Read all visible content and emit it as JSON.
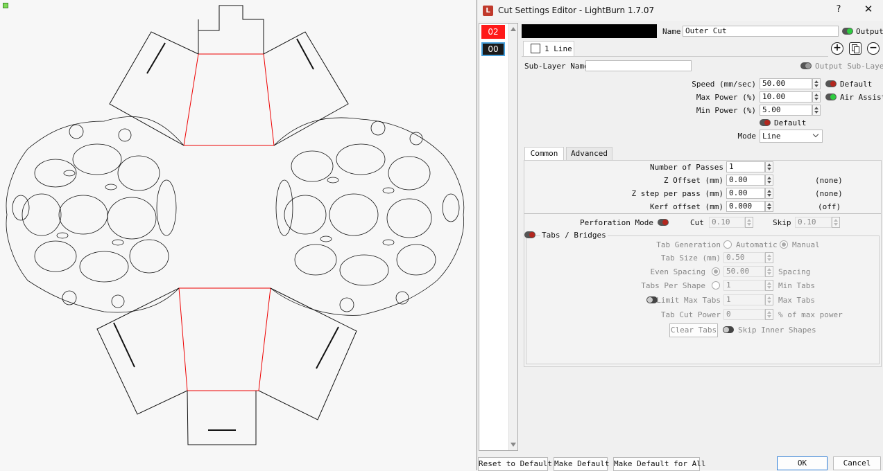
{
  "window": {
    "title": "Cut Settings Editor - LightBurn 1.7.07",
    "help": "?",
    "close": "✕"
  },
  "layers": [
    {
      "label": "02",
      "color": "#ff1a1a"
    },
    {
      "label": "00",
      "color": "#1a1a1a"
    }
  ],
  "header": {
    "name_label": "Name",
    "name_value": "Outer Cut",
    "output_label": "Output",
    "swatch_color": "#000000"
  },
  "sublayer_tab": {
    "label": "1 Line"
  },
  "sublayer": {
    "name_label": "Sub-Layer Name",
    "name_value": "",
    "output_sublayer_label": "Output Sub-Layer"
  },
  "speed": {
    "label": "Speed (mm/sec)",
    "value": "50.00",
    "default_label": "Default"
  },
  "max_power": {
    "label": "Max Power (%)",
    "value": "10.00",
    "air_assist_label": "Air Assist"
  },
  "min_power": {
    "label": "Min Power (%)",
    "value": "5.00"
  },
  "power_default_label": "Default",
  "mode": {
    "label": "Mode",
    "value": "Line"
  },
  "tabs": {
    "common": "Common",
    "advanced": "Advanced"
  },
  "passes": {
    "label": "Number of Passes",
    "value": "1"
  },
  "z_offset": {
    "label": "Z Offset (mm)",
    "value": "0.00",
    "note": "(none)"
  },
  "z_step": {
    "label": "Z step per pass (mm)",
    "value": "0.00",
    "note": "(none)"
  },
  "kerf": {
    "label": "Kerf offset (mm)",
    "value": "0.000",
    "note": "(off)"
  },
  "perforation": {
    "label": "Perforation Mode",
    "cut_label": "Cut",
    "cut_value": "0.10",
    "skip_label": "Skip",
    "skip_value": "0.10"
  },
  "tabs_bridges": {
    "label": "Tabs / Bridges",
    "generation_label": "Tab Generation",
    "automatic": "Automatic",
    "manual": "Manual",
    "size_label": "Tab Size (mm)",
    "size_value": "0.50",
    "even_spacing_label": "Even Spacing",
    "even_spacing_value": "50.00",
    "spacing_label": "Spacing",
    "per_shape_label": "Tabs Per Shape",
    "per_shape_value": "1",
    "min_tabs_label": "Min Tabs",
    "limit_max_label": "Limit Max Tabs",
    "limit_max_value": "1",
    "max_tabs_label": "Max Tabs",
    "cut_power_label": "Tab Cut Power",
    "cut_power_value": "0",
    "cut_power_unit": "% of max power",
    "clear_tabs": "Clear Tabs",
    "skip_inner_label": "Skip Inner Shapes"
  },
  "footer": {
    "reset": "Reset to Default",
    "make_default": "Make Default",
    "make_default_all": "Make Default for All",
    "ok": "OK",
    "cancel": "Cancel"
  },
  "colors": {
    "cut_red": "#ff1a1a",
    "cut_black": "#1a1a1a",
    "toggle_on": "#2ecc40",
    "toggle_off": "#b3261e"
  }
}
